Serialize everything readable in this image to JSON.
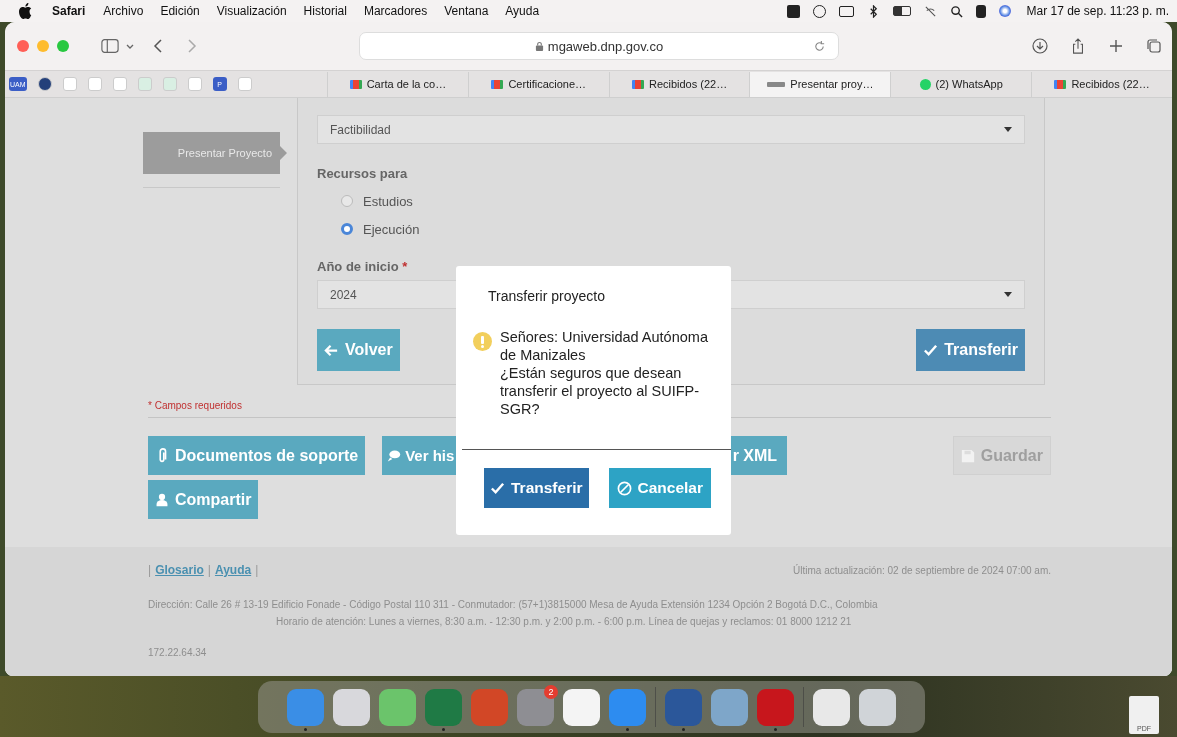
{
  "menubar": {
    "app": "Safari",
    "items": [
      "Archivo",
      "Edición",
      "Visualización",
      "Historial",
      "Marcadores",
      "Ventana",
      "Ayuda"
    ],
    "clock": "Mar 17 de sep. 11:23 p. m."
  },
  "toolbar": {
    "url": "mgaweb.dnp.gov.co"
  },
  "pinned_tabs": [
    {
      "kind": "label",
      "label": "UAM"
    },
    {
      "kind": "globe"
    },
    {
      "kind": "gmail"
    },
    {
      "kind": "knot"
    },
    {
      "kind": "crest"
    },
    {
      "kind": "green"
    },
    {
      "kind": "green"
    },
    {
      "kind": "crest"
    },
    {
      "kind": "label",
      "label": "P"
    },
    {
      "kind": "crest"
    }
  ],
  "tabs": [
    {
      "label": "Carta de la co…",
      "kind": "gmail",
      "selected": false
    },
    {
      "label": "Certificacione…",
      "kind": "gmail",
      "selected": false
    },
    {
      "label": "Recibidos (22…",
      "kind": "gmail",
      "selected": false
    },
    {
      "label": "Presentar proy…",
      "kind": "mga",
      "selected": true
    },
    {
      "label": "(2) WhatsApp",
      "kind": "whatsapp",
      "selected": false
    },
    {
      "label": "Recibidos (22…",
      "kind": "gmail",
      "selected": false
    }
  ],
  "sidebar": {
    "item": "Presentar Proyecto"
  },
  "form": {
    "stage_select": "Factibilidad",
    "resources_label": "Recursos para",
    "options": [
      {
        "label": "Estudios",
        "selected": false
      },
      {
        "label": "Ejecución",
        "selected": true
      }
    ],
    "year_label": "Año de inicio",
    "required_mark": "*",
    "year_select": "2024",
    "back_button": "Volver",
    "transfer_button": "Transferir"
  },
  "required_note": "* Campos requeridos",
  "actions": {
    "row1": [
      {
        "label": "Documentos de soporte",
        "kind": "paperclip"
      },
      {
        "label": "Ver his",
        "kind": "chat"
      },
      {
        "label": "r XML",
        "kind": "plain"
      }
    ],
    "save": {
      "label": "Guardar",
      "disabled": true
    },
    "row2": [
      {
        "label": "Compartir",
        "kind": "person"
      }
    ]
  },
  "footer": {
    "links": [
      {
        "kind": "separator",
        "label": "|"
      },
      {
        "kind": "link",
        "label": "Glosario"
      },
      {
        "kind": "separator",
        "label": "|"
      },
      {
        "kind": "link",
        "label": "Ayuda"
      },
      {
        "kind": "separator",
        "label": "|"
      }
    ],
    "updated": "Última actualización: 02 de septiembre de 2024 07:00 am.",
    "address": "Dirección: Calle 26 # 13-19 Edificio Fonade - Código Postal 110 311 - Conmutador: (57+1)3815000 Mesa de Ayuda Extensión 1234 Opción 2 Bogotá D.C., Colombia",
    "hours": "Horario de atención: Lunes a viernes, 8:30 a.m. - 12:30 p.m. y 2:00 p.m. - 6:00 p.m. Línea de quejas y reclamos: 01 8000 1212 21",
    "ip": "172.22.64.34"
  },
  "dialog": {
    "title": "Transferir proyecto",
    "message": [
      "Señores: Universidad Autónoma de Manizales",
      "¿Están seguros que desean transferir el proyecto al SUIFP-SGR?"
    ],
    "confirm": "Transferir",
    "cancel": "Cancelar"
  },
  "dock": [
    {
      "kind": "finder",
      "running": true
    },
    {
      "kind": "launchpad",
      "running": false
    },
    {
      "kind": "maps",
      "running": false
    },
    {
      "kind": "excel",
      "running": true
    },
    {
      "kind": "powerpoint",
      "running": false
    },
    {
      "kind": "settings",
      "running": false,
      "badge": "2"
    },
    {
      "kind": "freeform",
      "running": false
    },
    {
      "kind": "safari",
      "running": true
    },
    {
      "kind": "separator"
    },
    {
      "kind": "word",
      "running": true
    },
    {
      "kind": "preview",
      "running": false
    },
    {
      "kind": "acrobat",
      "running": true
    },
    {
      "kind": "separator"
    },
    {
      "kind": "sheet",
      "running": false
    },
    {
      "kind": "trash",
      "running": false
    }
  ],
  "desktop_file": {
    "label": "PDF"
  }
}
